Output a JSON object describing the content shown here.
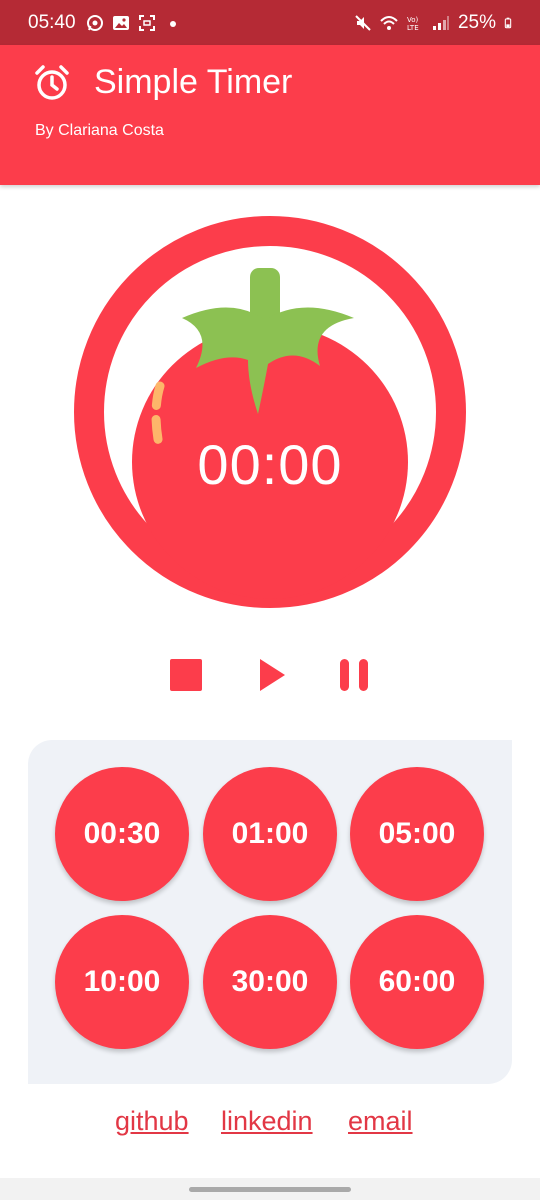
{
  "status_bar": {
    "time": "05:40",
    "battery": "25%",
    "left_icons": [
      "whatsapp-icon",
      "gallery-icon",
      "screenshot-icon",
      "dot-icon"
    ],
    "right_icons": [
      "mute-icon",
      "wifi-icon",
      "volte-icon",
      "signal-icon",
      "battery-icon"
    ]
  },
  "app_bar": {
    "title": "Simple Timer",
    "subtitle": "By Clariana Costa",
    "icon": "alarm-clock-icon"
  },
  "timer": {
    "display": "00:00"
  },
  "controls": {
    "stop_icon": "stop-icon",
    "play_icon": "play-icon",
    "pause_icon": "pause-icon"
  },
  "presets": [
    "00:30",
    "01:00",
    "05:00",
    "10:00",
    "30:00",
    "60:00"
  ],
  "links": {
    "github": "github",
    "linkedin": "linkedin",
    "email": "email"
  },
  "colors": {
    "primary": "#fc3d4b",
    "status_bar": "#b52a35",
    "leaf": "#8cc152",
    "highlight": "#fdb66a",
    "preset_panel": "#eff2f7"
  }
}
